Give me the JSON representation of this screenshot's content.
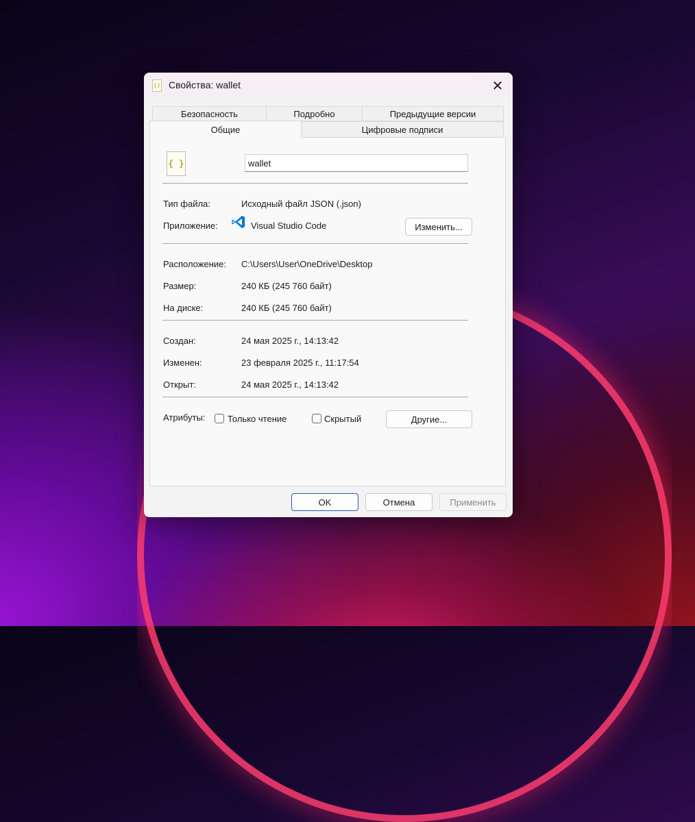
{
  "window": {
    "title": "Свойства: wallet",
    "close_glyph": "✕"
  },
  "tabs": {
    "row_top": [
      "Безопасность",
      "Подробно",
      "Предыдущие версии"
    ],
    "row_bottom": [
      "Общие",
      "Цифровые подписи"
    ],
    "active": "Общие"
  },
  "general": {
    "file_icon_glyph": "{ }",
    "file_name": "wallet",
    "file_type_label": "Тип файла:",
    "file_type_value": "Исходный файл JSON (.json)",
    "app_label": "Приложение:",
    "app_value": "Visual Studio Code",
    "change_button": "Изменить...",
    "location_label": "Расположение:",
    "location_value": "C:\\Users\\User\\OneDrive\\Desktop",
    "size_label": "Размер:",
    "size_value": "240 КБ (245 760 байт)",
    "disk_label": "На диске:",
    "disk_value": "240 КБ (245 760 байт)",
    "created_label": "Создан:",
    "created_value": "24 мая 2025 г., 14:13:42",
    "modified_label": "Изменен:",
    "modified_value": "23 февраля 2025 г., 11:17:54",
    "opened_label": "Открыт:",
    "opened_value": "24 мая 2025 г., 14:13:42",
    "attributes_label": "Атрибуты:",
    "readonly_label": "Только чтение",
    "readonly_checked": false,
    "hidden_label": "Скрытый",
    "hidden_checked": false,
    "other_button": "Другие..."
  },
  "footer": {
    "ok": "OK",
    "cancel": "Отмена",
    "apply": "Применить"
  },
  "colors": {
    "vscode_blue": "#0078d4",
    "json_icon": "#b8a82a"
  }
}
